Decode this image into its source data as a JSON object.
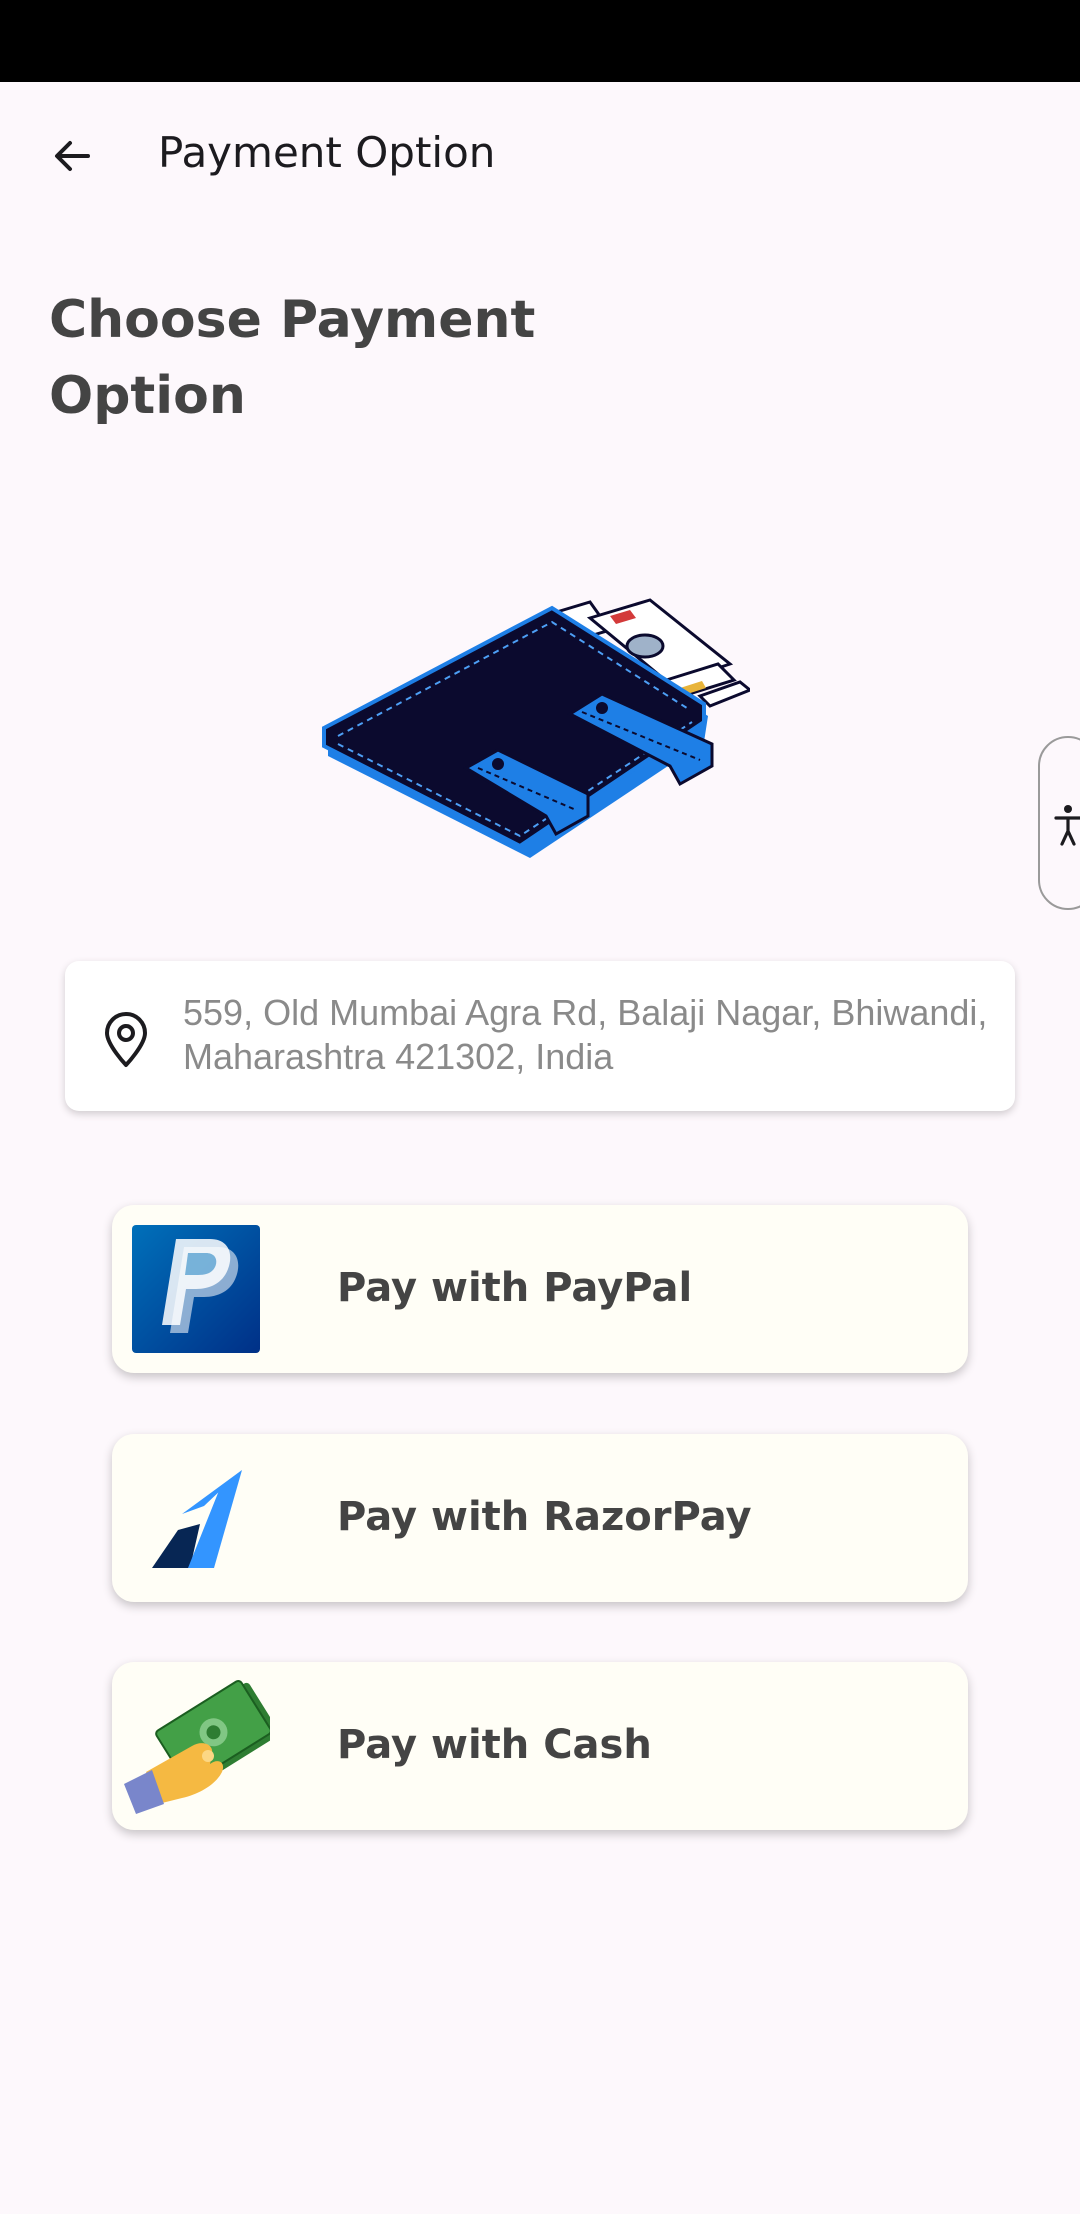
{
  "header": {
    "title": "Payment Option"
  },
  "main": {
    "heading": "Choose Payment Option"
  },
  "address": {
    "line1": "559, Old Mumbai Agra Rd, Balaji Nagar, Bhiwandi,",
    "line2": "Maharashtra 421302, India"
  },
  "payment_options": [
    {
      "label": "Pay with PayPal",
      "icon": "paypal-logo"
    },
    {
      "label": "Pay with RazorPay",
      "icon": "razorpay-logo"
    },
    {
      "label": "Pay with Cash",
      "icon": "cash-in-hand-icon"
    }
  ],
  "colors": {
    "background": "#fdf8fc",
    "card": "#fffef6",
    "text_dark": "#444444",
    "paypal_blue": "#003087",
    "razorpay_blue": "#3395ff",
    "wallet_navy": "#0b0a2e",
    "wallet_strap": "#1e7fe6"
  }
}
